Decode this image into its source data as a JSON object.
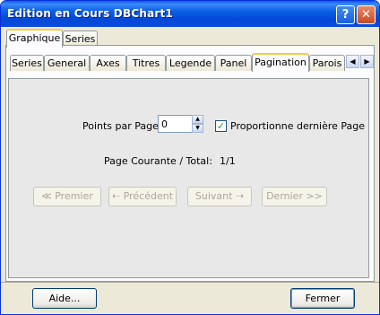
{
  "window": {
    "title": "Edition en Cours DBChart1",
    "help_glyph": "?",
    "close_glyph": "✕"
  },
  "top_tabs": [
    {
      "label": "Graphique"
    },
    {
      "label": "Series"
    }
  ],
  "sub_tabs": [
    {
      "label": "Series"
    },
    {
      "label": "General"
    },
    {
      "label": "Axes"
    },
    {
      "label": "Titres"
    },
    {
      "label": "Legende"
    },
    {
      "label": "Panel"
    },
    {
      "label": "Pagination"
    },
    {
      "label": "Parois"
    }
  ],
  "scroll": {
    "left": "◀",
    "right": "▶"
  },
  "pagination": {
    "points_label": "Points par Page:",
    "points_value": "0",
    "proportion_label": "Proportionne dernière Page",
    "proportion_checked": true,
    "current_label": "Page Courante / Total:",
    "current_value": "1/1"
  },
  "nav": {
    "first": "≪ Premier",
    "prev": "⇠ Précédent",
    "next": "Suivant ⇢",
    "last": "Dernier >>"
  },
  "footer": {
    "help": "Aide...",
    "close": "Fermer"
  },
  "colors": {
    "titlebar": "#0a5fe6",
    "tab_highlight": "#ffc83c",
    "check": "#21a121"
  }
}
